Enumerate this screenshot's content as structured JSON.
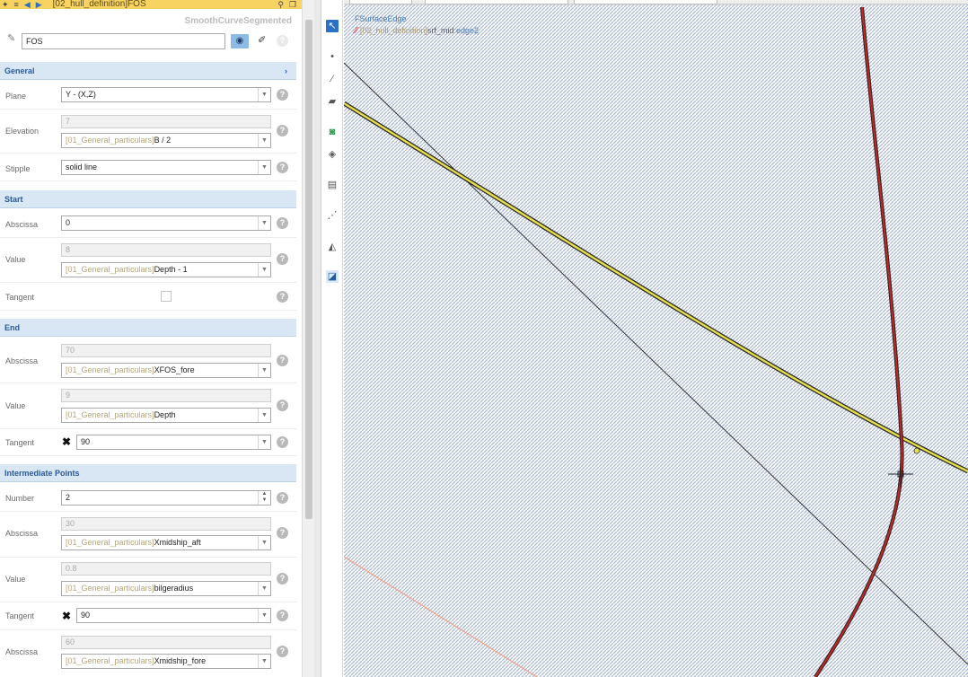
{
  "titlebar": {
    "title": "[02_hull_definition]FOS"
  },
  "type_label": "SmoothCurveSegmented",
  "name": {
    "value": "FOS"
  },
  "sections": {
    "general": "General",
    "start": "Start",
    "end": "End",
    "intermediate": "Intermediate Points"
  },
  "general": {
    "plane": {
      "label": "Plane",
      "value": "Y - (X,Z)"
    },
    "elevation": {
      "label": "Elevation",
      "calc": "7",
      "prefix": "[01_General_particulars]",
      "expr": "B / 2"
    },
    "stipple": {
      "label": "Stipple",
      "value": "solid line"
    }
  },
  "start": {
    "abscissa": {
      "label": "Abscissa",
      "value": "0"
    },
    "value": {
      "label": "Value",
      "calc": "8",
      "prefix": "[01_General_particulars]",
      "expr": "Depth - 1"
    },
    "tangent": {
      "label": "Tangent"
    }
  },
  "end": {
    "abscissa": {
      "label": "Abscissa",
      "calc": "70",
      "prefix": "[01_General_particulars]",
      "expr": "XFOS_fore"
    },
    "value": {
      "label": "Value",
      "calc": "9",
      "prefix": "[01_General_particulars]",
      "expr": "Depth"
    },
    "tangent": {
      "label": "Tangent",
      "value": "90"
    }
  },
  "intermediate": {
    "number": {
      "label": "Number",
      "value": "2"
    },
    "p1_abscissa": {
      "label": "Abscissa",
      "calc": "30",
      "prefix": "[01_General_particulars]",
      "expr": "Xmidship_aft"
    },
    "p1_value": {
      "label": "Value",
      "calc": "0.8",
      "prefix": "[01_General_particulars]",
      "expr": "bilgeradius"
    },
    "p1_tangent": {
      "label": "Tangent",
      "value": "90"
    },
    "p2_abscissa": {
      "label": "Abscissa",
      "calc": "60",
      "prefix": "[01_General_particulars]",
      "expr": "Xmidship_fore"
    }
  },
  "viewport": {
    "title": "FSurfaceEdge",
    "sub_prefix": "[02_hull_definition]",
    "sub_name": "srf_mid",
    "sub_sep": ":",
    "sub_edge": "edge2"
  },
  "colors": {
    "section_bg": "#d9e6f4",
    "section_text": "#2a5a9a",
    "titlebar": "#f7d361",
    "curve_red": "#cc2222",
    "curve_yellow": "#e8e04a"
  }
}
